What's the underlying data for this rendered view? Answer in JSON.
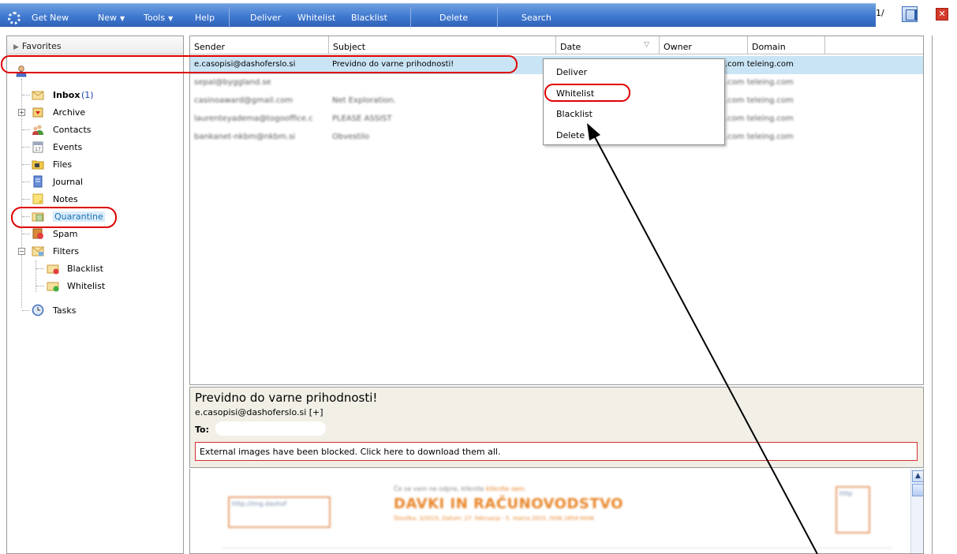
{
  "toolbar": {
    "get_new": "Get New",
    "new": "New",
    "tools": "Tools",
    "help": "Help",
    "deliver": "Deliver",
    "whitelist": "Whitelist",
    "blacklist": "Blacklist",
    "delete": "Delete",
    "search": "Search",
    "page_indicator": "1/",
    "close_glyph": "✕"
  },
  "sidebar": {
    "header": "Favorites",
    "items": [
      {
        "label": "Inbox",
        "count": "(1)",
        "icon": "inbox-icon"
      },
      {
        "label": "Archive",
        "icon": "archive-icon"
      },
      {
        "label": "Contacts",
        "icon": "contacts-icon"
      },
      {
        "label": "Events",
        "icon": "calendar-icon"
      },
      {
        "label": "Files",
        "icon": "folder-icon"
      },
      {
        "label": "Journal",
        "icon": "journal-icon"
      },
      {
        "label": "Notes",
        "icon": "notes-icon"
      },
      {
        "label": "Quarantine",
        "icon": "quarantine-icon"
      },
      {
        "label": "Spam",
        "icon": "spam-icon"
      },
      {
        "label": "Filters",
        "icon": "filters-icon"
      },
      {
        "label": "Blacklist",
        "icon": "blacklist-icon"
      },
      {
        "label": "Whitelist",
        "icon": "whitelist-icon"
      },
      {
        "label": "Tasks",
        "icon": "tasks-icon"
      }
    ]
  },
  "list": {
    "columns": [
      "Sender",
      "Subject",
      "Date",
      "Owner",
      "Domain"
    ],
    "rows": [
      {
        "sender": "e.casopisi@dashoferslo.si",
        "subject": "Previdno do varne prihodnosti!",
        "owner_domain": ".com teleing.com"
      },
      {
        "sender": "sepal@byggland.se",
        "subject": "",
        "owner_domain": ".com teleing.com"
      },
      {
        "sender": "casinoaward@gmail.com",
        "subject": "Net Exploration.",
        "owner_domain": ".com teleing.com"
      },
      {
        "sender": "laurenteyadema@togooffice.c",
        "subject": "PLEASE ASSIST",
        "owner_domain": ".com teleing.com"
      },
      {
        "sender": "bankanet-nkbm@nkbm.si",
        "subject": "Obvestilo",
        "owner_domain": ".com teleing.com"
      }
    ]
  },
  "context_menu": {
    "items": [
      "Deliver",
      "Whitelist",
      "Blacklist",
      "Delete"
    ]
  },
  "preview": {
    "subject": "Previdno do varne prihodnosti!",
    "from": "e.casopisi@dashoferslo.si [+]",
    "to_label": "To:",
    "blocked_notice": "External images have been blocked. Click here to download them all.",
    "body": {
      "top_line": "Če se vam ne odpre, kliknite",
      "top_link": "kliknite sem.",
      "heading": "DAVKI IN RAČUNOVODSTVO",
      "subline": "Številka: 3/2015, Datum: 27. februarja - 5. marca 2015, ISSN 1854-9446",
      "img_left": "http://img.dashof",
      "img_right": "http"
    }
  },
  "colors": {
    "toolbar": "#3f78cf",
    "highlight": "#e00000",
    "selected_row": "#c9e4f5",
    "accent_orange": "#e8862a"
  }
}
